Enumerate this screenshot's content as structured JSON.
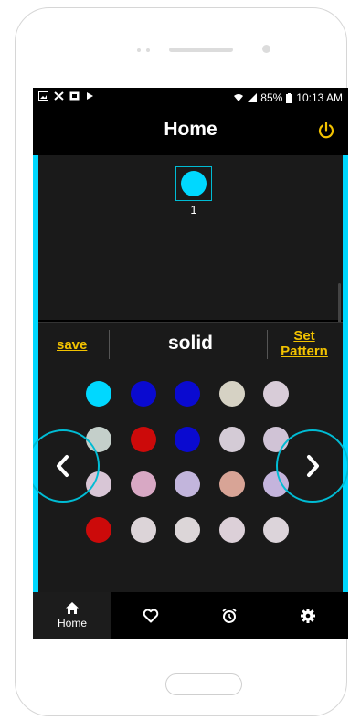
{
  "status_bar": {
    "left_icons": [
      "image-icon",
      "cross-icon",
      "media-icon",
      "play-icon"
    ],
    "battery": "85%",
    "time": "10:13 AM"
  },
  "header": {
    "title": "Home",
    "power_icon": "power-icon",
    "accent_color": "#f2c200"
  },
  "preview": {
    "selected_index_label": "1",
    "selected_color": "#00d8ff"
  },
  "toolbar": {
    "save_label": "save",
    "mode_label": "solid",
    "set_pattern_line1": "Set",
    "set_pattern_line2": "Pattern"
  },
  "palette": {
    "rows": [
      [
        "#00d8ff",
        "#0a0ad0",
        "#0a0ad0",
        "#d6d2c4",
        "#d8ccd8"
      ],
      [
        "#c4cfca",
        "#cc0a0a",
        "#0a0ad0",
        "#d4cbd6",
        "#d0c3d6"
      ],
      [
        "#d8c6d6",
        "#d8a8c4",
        "#c2b5dc",
        "#d8a496",
        "#c4b4dc"
      ],
      [
        "#cc0a0a",
        "#dcd4d8",
        "#dcd6d8",
        "#dcd0d8",
        "#dcd4da"
      ]
    ]
  },
  "navigation": {
    "prev_icon": "chevron-left-icon",
    "next_icon": "chevron-right-icon",
    "ring_color": "#00bcd4"
  },
  "tabs": [
    {
      "icon": "home-icon",
      "label": "Home",
      "active": true
    },
    {
      "icon": "heart-icon",
      "label": "",
      "active": false
    },
    {
      "icon": "alarm-icon",
      "label": "",
      "active": false
    },
    {
      "icon": "gear-icon",
      "label": "",
      "active": false
    }
  ]
}
